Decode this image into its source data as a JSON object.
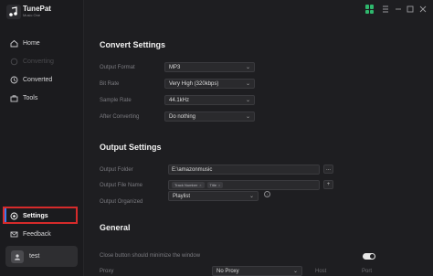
{
  "app": {
    "title": "TunePat",
    "subtitle": "Music One",
    "logo_icon": "music-note-icon"
  },
  "sidebar": {
    "items": [
      {
        "label": "Home",
        "icon": "home-icon",
        "state": "normal"
      },
      {
        "label": "Converting",
        "icon": "converting-icon",
        "state": "disabled"
      },
      {
        "label": "Converted",
        "icon": "clock-icon",
        "state": "normal"
      },
      {
        "label": "Tools",
        "icon": "toolbox-icon",
        "state": "normal"
      },
      {
        "label": "Settings",
        "icon": "gear-icon",
        "state": "active"
      },
      {
        "label": "Feedback",
        "icon": "mail-icon",
        "state": "normal"
      }
    ],
    "user": {
      "name": "test",
      "icon": "user-icon"
    }
  },
  "colors": {
    "accent": "#3a7cf0",
    "highlight_frame": "#d62b2b",
    "grid_icon": "#2fb86d"
  },
  "convert_settings": {
    "title": "Convert Settings",
    "output_format": {
      "label": "Output Format",
      "value": "MP3"
    },
    "bit_rate": {
      "label": "Bit Rate",
      "value": "Very High (320kbps)"
    },
    "sample_rate": {
      "label": "Sample Rate",
      "value": "44.1kHz"
    },
    "after_converting": {
      "label": "After Converting",
      "value": "Do nothing"
    }
  },
  "output_settings": {
    "title": "Output Settings",
    "output_folder": {
      "label": "Output Folder",
      "value": "E:\\amazonmusic",
      "button": "..."
    },
    "output_file_name": {
      "label": "Output File Name",
      "tags": [
        "Track Number",
        "Title"
      ],
      "button": "+"
    },
    "output_organized": {
      "label": "Output Organized",
      "value": "Playlist"
    }
  },
  "general": {
    "title": "General",
    "close_button": {
      "label": "Close button should minimize the window",
      "enabled": true
    },
    "proxy": {
      "label": "Proxy",
      "value": "No Proxy",
      "host_label": "Host",
      "port_label": "Port"
    }
  }
}
